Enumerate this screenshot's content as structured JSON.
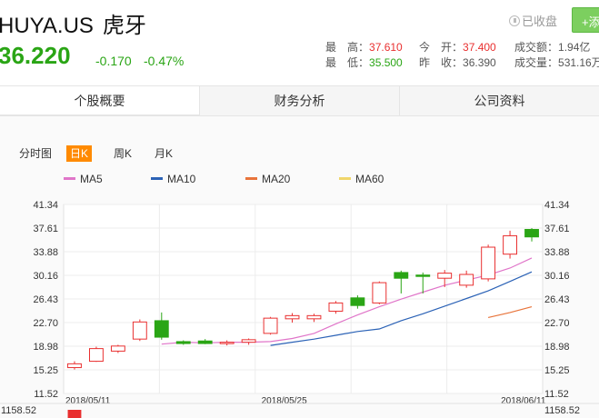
{
  "header": {
    "ticker": "HUYA.US",
    "name_cn": "虎牙",
    "last_price": "36.220",
    "change": "-0.170",
    "change_pct": "-0.47%",
    "favorite_label": "已收盘",
    "add_label": "+添",
    "quote": {
      "high_label": "最　高：",
      "high": "37.610",
      "low_label": "最　低：",
      "low": "35.500",
      "open_label": "今　开：",
      "open": "37.400",
      "prev_close_label": "昨　收：",
      "prev_close": "36.390",
      "turnover_label": "成交额：",
      "turnover": "1.94亿",
      "volume_label": "成交量：",
      "volume": "531.16万"
    }
  },
  "tabs": [
    "个股概要",
    "财务分析",
    "公司资料"
  ],
  "period_tabs": [
    "分时图",
    "日K",
    "周K",
    "月K"
  ],
  "colors": {
    "up": "#e93030",
    "down": "#2aa515",
    "ma5": "#e075c9",
    "ma10": "#2b62b6",
    "ma20": "#e8743b",
    "ma60": "#f0d66b",
    "tab_active": "#ff8a00"
  },
  "chart_data": {
    "type": "candlestick",
    "legend": [
      {
        "name": "MA5",
        "color": "#e075c9"
      },
      {
        "name": "MA10",
        "color": "#2b62b6"
      },
      {
        "name": "MA20",
        "color": "#e8743b"
      },
      {
        "name": "MA60",
        "color": "#f0d66b"
      }
    ],
    "y_ticks": [
      "41.34",
      "37.61",
      "33.88",
      "30.16",
      "26.43",
      "22.70",
      "18.98",
      "15.25",
      "11.52"
    ],
    "ylim": [
      11.52,
      41.34
    ],
    "volume_top_label": "1158.52",
    "x_labels": [
      {
        "label": "2018/05/11",
        "index": 0
      },
      {
        "label": "2018/05/25",
        "index": 9
      },
      {
        "label": "2018/06/11",
        "index": 20
      }
    ],
    "candles": [
      {
        "o": 15.6,
        "h": 16.6,
        "l": 15.3,
        "c": 16.2
      },
      {
        "o": 16.6,
        "h": 18.9,
        "l": 16.5,
        "c": 18.6
      },
      {
        "o": 18.2,
        "h": 19.2,
        "l": 17.9,
        "c": 19.0
      },
      {
        "o": 20.1,
        "h": 23.2,
        "l": 19.8,
        "c": 22.8
      },
      {
        "o": 23.0,
        "h": 24.3,
        "l": 20.0,
        "c": 20.4
      },
      {
        "o": 19.7,
        "h": 19.9,
        "l": 19.2,
        "c": 19.4
      },
      {
        "o": 19.8,
        "h": 20.1,
        "l": 19.3,
        "c": 19.4
      },
      {
        "o": 19.5,
        "h": 19.9,
        "l": 19.1,
        "c": 19.6
      },
      {
        "o": 19.6,
        "h": 20.2,
        "l": 19.2,
        "c": 20.0
      },
      {
        "o": 21.0,
        "h": 23.6,
        "l": 20.8,
        "c": 23.4
      },
      {
        "o": 23.3,
        "h": 24.2,
        "l": 22.7,
        "c": 23.8
      },
      {
        "o": 23.3,
        "h": 24.1,
        "l": 22.8,
        "c": 23.8
      },
      {
        "o": 24.5,
        "h": 26.1,
        "l": 24.1,
        "c": 25.8
      },
      {
        "o": 26.6,
        "h": 27.0,
        "l": 24.9,
        "c": 25.4
      },
      {
        "o": 25.8,
        "h": 29.2,
        "l": 25.6,
        "c": 29.0
      },
      {
        "o": 30.6,
        "h": 30.9,
        "l": 27.3,
        "c": 29.7
      },
      {
        "o": 30.2,
        "h": 30.6,
        "l": 27.3,
        "c": 30.0
      },
      {
        "o": 29.7,
        "h": 31.0,
        "l": 28.3,
        "c": 30.5
      },
      {
        "o": 28.6,
        "h": 30.9,
        "l": 28.2,
        "c": 30.3
      },
      {
        "o": 29.6,
        "h": 35.0,
        "l": 29.2,
        "c": 34.6
      },
      {
        "o": 33.5,
        "h": 37.2,
        "l": 32.8,
        "c": 36.4
      },
      {
        "o": 37.4,
        "h": 37.61,
        "l": 35.5,
        "c": 36.22
      }
    ],
    "ma5": [
      null,
      null,
      null,
      null,
      19.3,
      19.6,
      19.5,
      19.6,
      19.6,
      19.7,
      20.2,
      21.0,
      22.5,
      23.9,
      25.2,
      26.4,
      27.5,
      28.6,
      29.4,
      30.2,
      31.3,
      32.9
    ],
    "ma10": [
      null,
      null,
      null,
      null,
      null,
      null,
      null,
      null,
      null,
      19.1,
      19.6,
      20.1,
      20.7,
      21.3,
      21.7,
      23.0,
      24.1,
      25.3,
      26.5,
      27.7,
      29.2,
      30.7
    ],
    "ma20": [
      null,
      null,
      null,
      null,
      null,
      null,
      null,
      null,
      null,
      null,
      null,
      null,
      null,
      null,
      null,
      null,
      null,
      null,
      null,
      23.5,
      24.3,
      25.2
    ]
  }
}
